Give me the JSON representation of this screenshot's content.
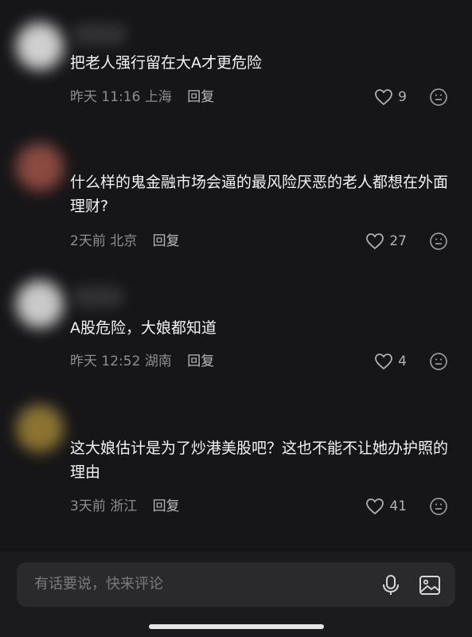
{
  "comments": [
    {
      "text": "把老人强行留在大A才更危险",
      "time": "昨天 11:16",
      "location": "上海",
      "reply": "回复",
      "likes": "9"
    },
    {
      "text": "什么样的鬼金融市场会逼的最风险厌恶的老人都想在外面理财?",
      "time": "2天前",
      "location": "北京",
      "reply": "回复",
      "likes": "27"
    },
    {
      "text": "A股危险，大娘都知道",
      "time": "昨天 12:52",
      "location": "湖南",
      "reply": "回复",
      "likes": "4"
    },
    {
      "text": "这大娘估计是为了炒港美股吧？这也不能不让她办护照的理由",
      "time": "3天前",
      "location": "浙江",
      "reply": "回复",
      "likes": "41"
    }
  ],
  "input": {
    "placeholder": "有话要说，快来评论"
  },
  "icons": {
    "like": "heart-outline-icon",
    "emoji": "smiley-face-icon",
    "mic": "microphone-icon",
    "image": "image-icon"
  },
  "colors": {
    "background": "#161618",
    "text": "#f2f2f2",
    "meta": "#8d8d92"
  }
}
